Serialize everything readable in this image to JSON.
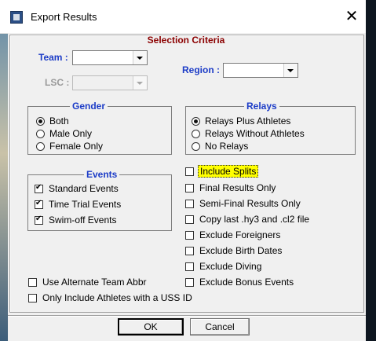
{
  "window": {
    "title": "Export Results",
    "close_glyph": "✕"
  },
  "header": {
    "title": "Selection Criteria"
  },
  "fields": {
    "team": {
      "label": "Team :",
      "value": ""
    },
    "lsc": {
      "label": "LSC :",
      "value": ""
    },
    "region": {
      "label": "Region :",
      "value": ""
    }
  },
  "gender": {
    "title": "Gender",
    "options": [
      {
        "label": "Both",
        "selected": true
      },
      {
        "label": "Male Only",
        "selected": false
      },
      {
        "label": "Female Only",
        "selected": false
      }
    ]
  },
  "relays": {
    "title": "Relays",
    "options": [
      {
        "label": "Relays Plus Athletes",
        "selected": true
      },
      {
        "label": "Relays Without Athletes",
        "selected": false
      },
      {
        "label": "No Relays",
        "selected": false
      }
    ]
  },
  "events": {
    "title": "Events",
    "options": [
      {
        "label": "Standard Events",
        "checked": true
      },
      {
        "label": "Time Trial Events",
        "checked": true
      },
      {
        "label": "Swim-off Events",
        "checked": true
      }
    ]
  },
  "options": [
    {
      "label": "Include Splits",
      "checked": false,
      "focused": true
    },
    {
      "label": "Final Results Only",
      "checked": false
    },
    {
      "label": "Semi-Final Results Only",
      "checked": false
    },
    {
      "label": "Copy last .hy3 and .cl2 file",
      "checked": false
    },
    {
      "label": "Exclude Foreigners",
      "checked": false
    },
    {
      "label": "Exclude Birth Dates",
      "checked": false
    },
    {
      "label": "Exclude Diving",
      "checked": false
    },
    {
      "label": "Exclude Bonus Events",
      "checked": false
    }
  ],
  "misc": [
    {
      "label": "Use Alternate Team Abbr",
      "checked": false
    },
    {
      "label": "Only Include Athletes with a USS ID",
      "checked": false
    }
  ],
  "buttons": {
    "ok": "OK",
    "cancel": "Cancel"
  },
  "colors": {
    "accent_label": "#1c3cc7",
    "title_label": "#8b0000",
    "highlight": "#ffff00"
  }
}
